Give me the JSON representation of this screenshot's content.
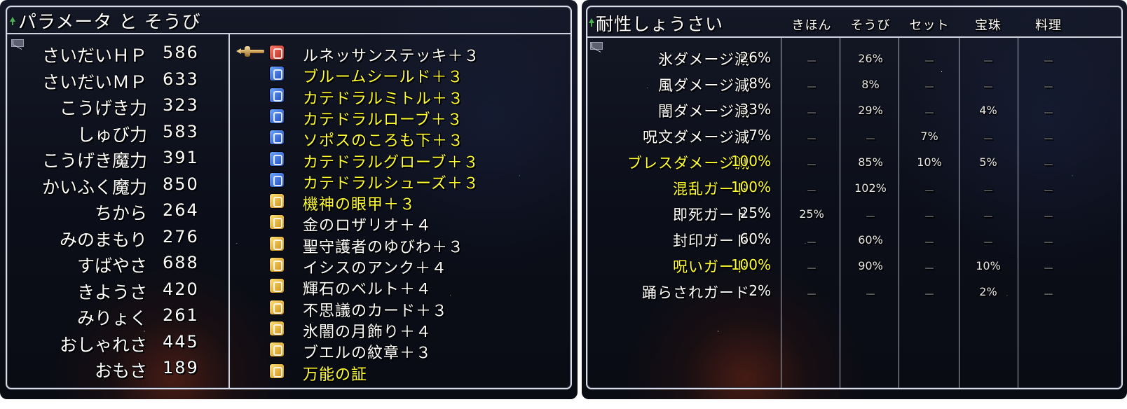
{
  "left_window": {
    "title": "パラメータ と そうび",
    "stats": [
      {
        "label": "さいだいＨＰ",
        "value": "586"
      },
      {
        "label": "さいだいＭＰ",
        "value": "633"
      },
      {
        "label": "こうげき力",
        "value": "323"
      },
      {
        "label": "しゅび力",
        "value": "583"
      },
      {
        "label": "こうげき魔力",
        "value": "391"
      },
      {
        "label": "かいふく魔力",
        "value": "850"
      },
      {
        "label": "ちから",
        "value": "264"
      },
      {
        "label": "みのまもり",
        "value": "276"
      },
      {
        "label": "すばやさ",
        "value": "688"
      },
      {
        "label": "きようさ",
        "value": "420"
      },
      {
        "label": "みりょく",
        "value": "261"
      },
      {
        "label": "おしゃれさ",
        "value": "445"
      },
      {
        "label": "おもさ",
        "value": "189"
      }
    ],
    "equipment": [
      {
        "name": "ルネッサンステッキ＋３",
        "color": "#ffffff",
        "icon": "staff-icon"
      },
      {
        "name": "ブルームシールド＋３",
        "color": "#ffff33",
        "icon": "shield-icon"
      },
      {
        "name": "カテドラルミトル＋３",
        "color": "#ffff33",
        "icon": "head-armor-icon"
      },
      {
        "name": "カテドラルローブ＋３",
        "color": "#ffff33",
        "icon": "body-armor-icon"
      },
      {
        "name": "ソポスのころも下＋３",
        "color": "#ffff33",
        "icon": "leg-armor-icon"
      },
      {
        "name": "カテドラルグローブ＋３",
        "color": "#ffff33",
        "icon": "glove-icon"
      },
      {
        "name": "カテドラルシューズ＋３",
        "color": "#ffff33",
        "icon": "shoe-icon"
      },
      {
        "name": "機神の眼甲＋３",
        "color": "#ffff33",
        "icon": "face-accessory-icon"
      },
      {
        "name": "金のロザリオ＋４",
        "color": "#ffffff",
        "icon": "neck-accessory-icon"
      },
      {
        "name": "聖守護者のゆびわ＋３",
        "color": "#ffffff",
        "icon": "ring-icon"
      },
      {
        "name": "イシスのアンク＋４",
        "color": "#ffffff",
        "icon": "hand-accessory-icon"
      },
      {
        "name": "輝石のベルト＋４",
        "color": "#ffffff",
        "icon": "belt-icon"
      },
      {
        "name": "不思議のカード＋３",
        "color": "#ffffff",
        "icon": "card-icon"
      },
      {
        "name": "氷闇の月飾り＋４",
        "color": "#ffffff",
        "icon": "other-accessory-icon"
      },
      {
        "name": "ブエルの紋章＋３",
        "color": "#ffffff",
        "icon": "crest-icon"
      },
      {
        "name": "万能の証",
        "color": "#ffff33",
        "icon": "proof-icon"
      }
    ]
  },
  "right_window": {
    "title": "耐性しょうさい",
    "columns": [
      "きほん",
      "そうび",
      "セット",
      "宝珠",
      "料理"
    ],
    "rows": [
      {
        "label": "氷ダメージ減",
        "total": "26%",
        "color": "#ffffff",
        "cells": [
          "－",
          "26%",
          "－",
          "－",
          "－"
        ]
      },
      {
        "label": "風ダメージ減",
        "total": "8%",
        "color": "#ffffff",
        "cells": [
          "－",
          "8%",
          "－",
          "－",
          "－"
        ]
      },
      {
        "label": "闇ダメージ減",
        "total": "33%",
        "color": "#ffffff",
        "cells": [
          "－",
          "29%",
          "－",
          "4%",
          "－"
        ]
      },
      {
        "label": "呪文ダメージ減",
        "total": "7%",
        "color": "#ffffff",
        "cells": [
          "－",
          "－",
          "7%",
          "－",
          "－"
        ]
      },
      {
        "label": "ブレスダメージ減",
        "total": "100%",
        "color": "#ffff33",
        "cells": [
          "－",
          "85%",
          "10%",
          "5%",
          "－"
        ]
      },
      {
        "label": "混乱ガード",
        "total": "100%",
        "color": "#ffff33",
        "cells": [
          "－",
          "102%",
          "－",
          "－",
          "－"
        ]
      },
      {
        "label": "即死ガード",
        "total": "25%",
        "color": "#ffffff",
        "cells": [
          "25%",
          "－",
          "－",
          "－",
          "－"
        ]
      },
      {
        "label": "封印ガード",
        "total": "60%",
        "color": "#ffffff",
        "cells": [
          "－",
          "60%",
          "－",
          "－",
          "－"
        ]
      },
      {
        "label": "呪いガード",
        "total": "100%",
        "color": "#ffff33",
        "cells": [
          "－",
          "90%",
          "－",
          "10%",
          "－"
        ]
      },
      {
        "label": "踊らされガード",
        "total": "2%",
        "color": "#ffffff",
        "cells": [
          "－",
          "－",
          "－",
          "2%",
          "－"
        ]
      }
    ]
  }
}
